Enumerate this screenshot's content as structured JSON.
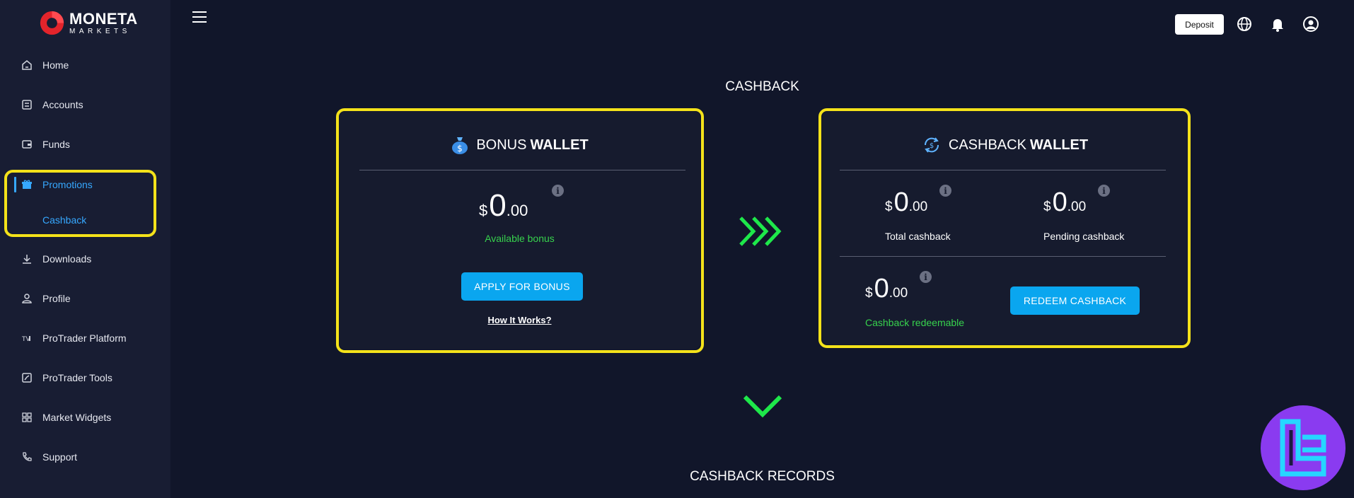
{
  "brand": {
    "name": "MONETA",
    "sub": "MARKETS"
  },
  "sidebar": {
    "items": [
      {
        "label": "Home",
        "icon": "home-icon"
      },
      {
        "label": "Accounts",
        "icon": "accounts-icon"
      },
      {
        "label": "Funds",
        "icon": "wallet-icon"
      },
      {
        "label": "Promotions",
        "icon": "gift-icon"
      },
      {
        "label": "Downloads",
        "icon": "download-icon"
      },
      {
        "label": "Profile",
        "icon": "user-icon"
      },
      {
        "label": "ProTrader Platform",
        "icon": "platform-icon"
      },
      {
        "label": "ProTrader Tools",
        "icon": "chart-icon"
      },
      {
        "label": "Market Widgets",
        "icon": "grid-icon"
      },
      {
        "label": "Support",
        "icon": "phone-icon"
      }
    ],
    "sub_item": "Cashback"
  },
  "header": {
    "deposit_label": "Deposit"
  },
  "main": {
    "title": "CASHBACK",
    "records_title": "CASHBACK RECORDS",
    "bonus_wallet": {
      "title_regular": "BONUS",
      "title_bold": "WALLET",
      "currency": "$",
      "amount_int": "0",
      "amount_dec": ".00",
      "caption": "Available bonus",
      "button": "APPLY FOR BONUS",
      "link": "How It Works?"
    },
    "cashback_wallet": {
      "title_regular": "CASHBACK",
      "title_bold": "WALLET",
      "total": {
        "currency": "$",
        "int": "0",
        "dec": ".00",
        "label": "Total cashback"
      },
      "pending": {
        "currency": "$",
        "int": "0",
        "dec": ".00",
        "label": "Pending cashback"
      },
      "redeemable": {
        "currency": "$",
        "int": "0",
        "dec": ".00",
        "label": "Cashback redeemable"
      },
      "button": "REDEEM CASHBACK"
    }
  },
  "colors": {
    "accent_blue": "#0aa6ef",
    "active_nav": "#36a8ff",
    "green": "#37d24d",
    "highlight": "#f4e21a"
  }
}
